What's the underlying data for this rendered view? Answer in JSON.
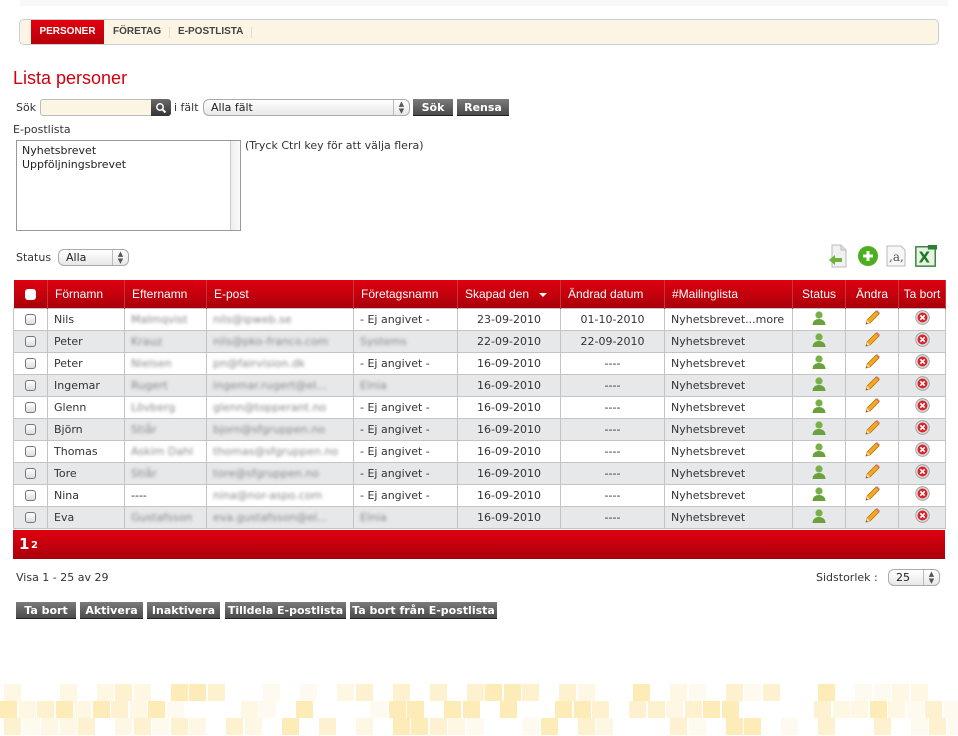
{
  "nav": {
    "tabs": [
      {
        "label": "PERSONER",
        "active": true
      },
      {
        "label": "FÖRETAG",
        "active": false
      },
      {
        "label": "E-POSTLISTA",
        "active": false
      }
    ]
  },
  "page_title": "Lista personer",
  "search": {
    "label": "Sök",
    "value": "",
    "field_label": "i fält",
    "field_selected": "Alla fält",
    "search_button": "Sök",
    "clear_button": "Rensa"
  },
  "mailing_list": {
    "label": "E-postlista",
    "options": [
      "Nyhetsbrevet",
      "Uppföljningsbrevet"
    ],
    "hint": "(Tryck Ctrl key för att välja flera)"
  },
  "status_filter": {
    "label": "Status",
    "selected": "Alla"
  },
  "toolbar": {
    "icons": [
      "import-icon",
      "add-icon",
      "text-format-icon",
      "excel-export-icon"
    ]
  },
  "table": {
    "headers": [
      "Förnamn",
      "Efternamn",
      "E-post",
      "Företagsnamn",
      "Skapad den",
      "Ändrad datum",
      "#Mailinglista",
      "Status",
      "Ändra",
      "Ta bort"
    ],
    "sorted_column": "Skapad den",
    "rows": [
      {
        "first": "Nils",
        "last": "Malmqvist",
        "email": "nils@ipweb.se",
        "company": "- Ej angivet -",
        "company_blurred": false,
        "created": "23-09-2010",
        "modified": "01-10-2010",
        "list": "Nyhetsbrevet...more",
        "last_blurred": true
      },
      {
        "first": "Peter",
        "last": "Krauz",
        "email": "nils@pko-franco.com",
        "company": "Systems",
        "company_blurred": true,
        "created": "22-09-2010",
        "modified": "22-09-2010",
        "list": "Nyhetsbrevet",
        "last_blurred": true
      },
      {
        "first": "Peter",
        "last": "Nielsen",
        "email": "pn@fairvision.dk",
        "company": "- Ej angivet -",
        "company_blurred": false,
        "created": "16-09-2010",
        "modified": "----",
        "list": "Nyhetsbrevet",
        "last_blurred": true
      },
      {
        "first": "Ingemar",
        "last": "Rugert",
        "email": "ingemar.rugert@el...",
        "company": "Elnia",
        "company_blurred": true,
        "created": "16-09-2010",
        "modified": "----",
        "list": "Nyhetsbrevet",
        "last_blurred": true
      },
      {
        "first": "Glenn",
        "last": "Lövberg",
        "email": "glenn@topperant.no",
        "company": "- Ej angivet -",
        "company_blurred": false,
        "created": "16-09-2010",
        "modified": "----",
        "list": "Nyhetsbrevet",
        "last_blurred": true
      },
      {
        "first": "Björn",
        "last": "Stiår",
        "email": "bjorn@sfgruppen.no",
        "company": "- Ej angivet -",
        "company_blurred": false,
        "created": "16-09-2010",
        "modified": "----",
        "list": "Nyhetsbrevet",
        "last_blurred": true
      },
      {
        "first": "Thomas",
        "last": "Askim Dahl",
        "email": "thomas@sfgruppen.no",
        "company": "- Ej angivet -",
        "company_blurred": false,
        "created": "16-09-2010",
        "modified": "----",
        "list": "Nyhetsbrevet",
        "last_blurred": true
      },
      {
        "first": "Tore",
        "last": "Stiår",
        "email": "tore@sfgruppen.no",
        "company": "- Ej angivet -",
        "company_blurred": false,
        "created": "16-09-2010",
        "modified": "----",
        "list": "Nyhetsbrevet",
        "last_blurred": true
      },
      {
        "first": "Nina",
        "last": "----",
        "email": "nina@nor-aspo.com",
        "company": "- Ej angivet -",
        "company_blurred": false,
        "created": "16-09-2010",
        "modified": "----",
        "list": "Nyhetsbrevet",
        "last_blurred": false
      },
      {
        "first": "Eva",
        "last": "Gustafsson",
        "email": "eva.gustafsson@el...",
        "company": "Elnia",
        "company_blurred": true,
        "created": "16-09-2010",
        "modified": "----",
        "list": "Nyhetsbrevet",
        "last_blurred": true
      }
    ]
  },
  "pager": {
    "current": "1",
    "pages": [
      "2"
    ]
  },
  "summary": "Visa 1 - 25 av 29",
  "page_size": {
    "label": "Sidstorlek :",
    "selected": "25"
  },
  "actions": [
    "Ta bort",
    "Aktivera",
    "Inaktivera",
    "Tilldela E-postlista",
    "Ta bort från E-postlista"
  ],
  "colors": {
    "brand_red": "#d2000d",
    "nav_bg": "#fdf5e4",
    "status_green": "#6aa84f",
    "delete_red": "#d7262e",
    "pencil_orange": "#f5a623"
  }
}
